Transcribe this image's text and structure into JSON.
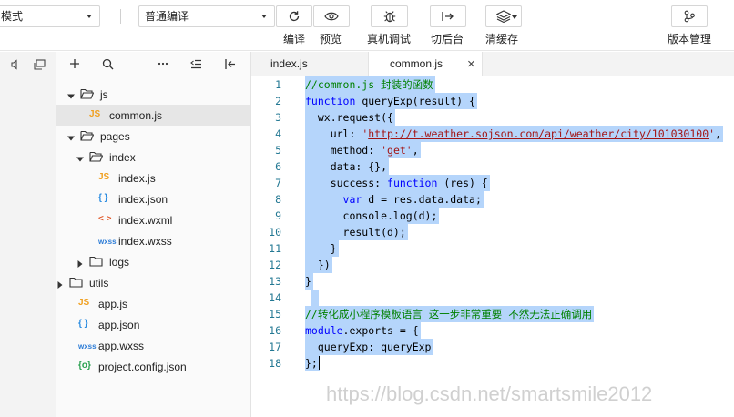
{
  "toolbar": {
    "mode_select": "模式",
    "compile_select": "普通编译",
    "buttons": [
      {
        "label": "编译",
        "icon": "refresh-icon"
      },
      {
        "label": "预览",
        "icon": "eye-icon"
      },
      {
        "label": "真机调试",
        "icon": "bug-icon"
      },
      {
        "label": "切后台",
        "icon": "switch-background-icon"
      },
      {
        "label": "清缓存",
        "icon": "layers-icon"
      },
      {
        "label": "版本管理",
        "icon": "branch-icon"
      }
    ]
  },
  "explorer": {
    "tree": [
      {
        "name": "js",
        "type": "folder",
        "open": true
      },
      {
        "name": "common.js",
        "type": "js",
        "selected": true
      },
      {
        "name": "pages",
        "type": "folder",
        "open": true
      },
      {
        "name": "index",
        "type": "folder",
        "open": true
      },
      {
        "name": "index.js",
        "type": "js"
      },
      {
        "name": "index.json",
        "type": "json"
      },
      {
        "name": "index.wxml",
        "type": "wxml"
      },
      {
        "name": "index.wxss",
        "type": "wxss"
      },
      {
        "name": "logs",
        "type": "folder",
        "open": false
      },
      {
        "name": "utils",
        "type": "folder",
        "open": false
      },
      {
        "name": "app.js",
        "type": "js"
      },
      {
        "name": "app.json",
        "type": "json"
      },
      {
        "name": "app.wxss",
        "type": "wxss"
      },
      {
        "name": "project.config.json",
        "type": "config"
      }
    ],
    "ext_badges": {
      "js": "JS",
      "json": "{ }",
      "wxml": "< >",
      "wxss": "wxss",
      "config": "{o}"
    }
  },
  "tabs": [
    {
      "label": "index.js",
      "active": false
    },
    {
      "label": "common.js",
      "active": true,
      "close": "×"
    }
  ],
  "code": {
    "line_numbers": [
      "1",
      "2",
      "3",
      "4",
      "5",
      "6",
      "7",
      "8",
      "9",
      "10",
      "11",
      "12",
      "13",
      "14",
      "15",
      "16",
      "17",
      "18"
    ],
    "l1": "//common.js 封装的函数",
    "l2_kw": "function",
    "l2_rest": " queryExp(result) {",
    "l3": "  wx.request({",
    "l4_a": "    url: ",
    "l4_q1": "'",
    "l4_url": "http://t.weather.sojson.com/api/weather/city/101030100",
    "l4_q2": "'",
    "l4_b": ",",
    "l5_a": "    method: ",
    "l5_str": "'get'",
    "l5_b": ",",
    "l6": "    data: {},",
    "l7_a": "    success: ",
    "l7_kw": "function",
    "l7_b": " (res) {",
    "l8_a": "      ",
    "l8_kw": "var",
    "l8_b": " d = res.data.data;",
    "l9": "      console.log(d);",
    "l10": "      result(d);",
    "l11": "    }",
    "l12": "  })",
    "l13": "}",
    "l14": " ",
    "l15": "//转化成小程序模板语言 这一步非常重要 不然无法正确调用",
    "l16_a": "module",
    "l16_b": ".exports = {",
    "l17": "  queryExp: queryExp",
    "l18": "};"
  },
  "watermark": "https://blog.csdn.net/smartsmile2012"
}
